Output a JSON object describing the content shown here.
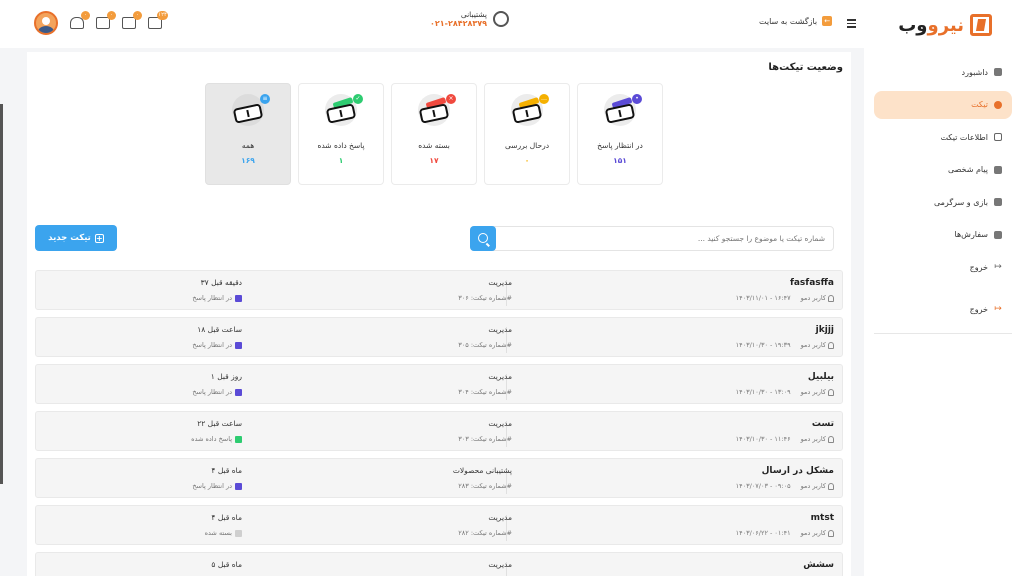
{
  "brand": {
    "name_orange": "نیرو",
    "name_dark": "وب"
  },
  "sidebar": {
    "items": [
      {
        "label": "داشبورد",
        "icon": "grid-icon"
      },
      {
        "label": "تیکت",
        "icon": "ticket-icon",
        "active": true
      },
      {
        "label": "اطلاعات تیکت",
        "icon": "info-icon"
      },
      {
        "label": "پیام شخصی",
        "icon": "message-icon"
      },
      {
        "label": "بازی و سرگرمی",
        "icon": "gamepad-icon"
      },
      {
        "label": "سفارش‌ها",
        "icon": "cart-icon"
      },
      {
        "label": "خروج",
        "icon": "logout-icon"
      },
      {
        "label": "خروج",
        "icon": "logout-icon"
      }
    ]
  },
  "header": {
    "back_label": "بازگشت به سایت",
    "support_label": "پشتیبانی",
    "support_phone": "۰۲۱-۲۸۴۲۸۳۷۹",
    "badges": {
      "cards": "۱۲۴",
      "gift": "۰",
      "mail": "۰",
      "bell": "۰"
    }
  },
  "section_title": "وضعیت تیکت‌ها",
  "status_cards": [
    {
      "label": "در انتظار پاسخ",
      "count": "۱۵۱",
      "color": "#5b4bd6"
    },
    {
      "label": "درحال بررسی",
      "count": "۰",
      "color": "#f5b000"
    },
    {
      "label": "بسته شده",
      "count": "۱۷",
      "color": "#f0493e"
    },
    {
      "label": "پاسخ داده شده",
      "count": "۱",
      "color": "#2ecc71"
    },
    {
      "label": "همه",
      "count": "۱۶۹",
      "color": "#3ba4ee"
    }
  ],
  "new_ticket_label": "تیکت جدید",
  "search": {
    "placeholder": "شماره تیکت یا موضوع را جستجو کنید ..."
  },
  "tickets": [
    {
      "title": "fasfasffa",
      "user": "کاربر دمو",
      "date": "۱۴۰۳/۱۱/۰۱ - ۱۶:۴۷",
      "dept": "مدیریت",
      "number": "شماره تیکت: ۳۰۶#",
      "time": "۳۷ دقیقه قبل",
      "status": "در انتظار پاسخ",
      "status_color": "#5b4bd6"
    },
    {
      "title": "jkjjj",
      "user": "کاربر دمو",
      "date": "۱۴۰۳/۱۰/۳۰ - ۱۹:۳۹",
      "dept": "مدیریت",
      "number": "شماره تیکت: ۳۰۵#",
      "time": "۱۸ ساعت قبل",
      "status": "در انتظار پاسخ",
      "status_color": "#5b4bd6"
    },
    {
      "title": "بیلبیل",
      "user": "کاربر دمو",
      "date": "۱۴۰۳/۱۰/۳۰ - ۱۳:۰۹",
      "dept": "مدیریت",
      "number": "شماره تیکت: ۳۰۴#",
      "time": "۱ روز قبل",
      "status": "در انتظار پاسخ",
      "status_color": "#5b4bd6"
    },
    {
      "title": "تست",
      "user": "کاربر دمو",
      "date": "۱۴۰۳/۱۰/۳۰ - ۱۱:۴۶",
      "dept": "مدیریت",
      "number": "شماره تیکت: ۳۰۳#",
      "time": "۲۲ ساعت قبل",
      "status": "پاسخ داده شده",
      "status_color": "#2ecc71"
    },
    {
      "title": "مشکل در ارسال",
      "user": "کاربر دمو",
      "date": "۱۴۰۳/۰۷/۰۳ - ۰۹:۰۵",
      "dept": "پشتیبانی محصولات",
      "number": "شماره تیکت: ۲۸۳#",
      "time": "۴ ماه قبل",
      "status": "در انتظار پاسخ",
      "status_color": "#5b4bd6"
    },
    {
      "title": "mtst",
      "user": "کاربر دمو",
      "date": "۱۴۰۳/۰۶/۲۲ - ۰۱:۴۱",
      "dept": "مدیریت",
      "number": "شماره تیکت: ۲۸۲#",
      "time": "۴ ماه قبل",
      "status": "بسته شده",
      "status_color": "#cfcfcf"
    },
    {
      "title": "سشش",
      "user": "",
      "date": "",
      "dept": "مدیریت",
      "number": "",
      "time": "۵ ماه قبل",
      "status": "",
      "status_color": "#cfcfcf"
    }
  ]
}
